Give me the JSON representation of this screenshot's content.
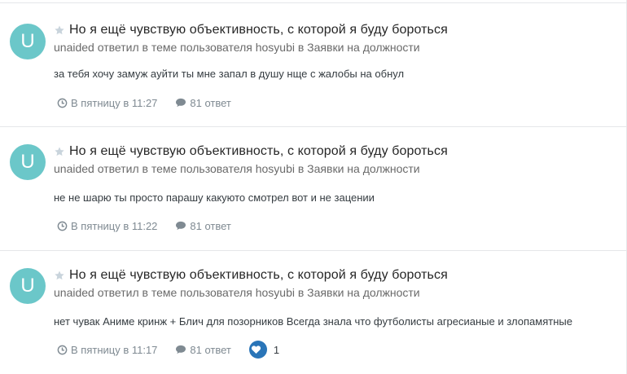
{
  "posts": [
    {
      "avatar_letter": "U",
      "title": "Но я ещё чувствую объективность, с которой я буду бороться",
      "subline": "unaided ответил в теме пользователя hosyubi в Заявки на должности",
      "excerpt": "за тебя хочу замуж ayйти ты мне запал в душу нще с жалобы на обнул",
      "time": "В пятницу в 11:27",
      "replies": "81 ответ",
      "reactions": null
    },
    {
      "avatar_letter": "U",
      "title": "Но я ещё чувствую объективность, с которой я буду бороться",
      "subline": "unaided ответил в теме пользователя hosyubi в Заявки на должности",
      "excerpt": "не не шарю ты просто парашу какуюто смотрел вот и не зацении",
      "time": "В пятницу в 11:22",
      "replies": "81 ответ",
      "reactions": null
    },
    {
      "avatar_letter": "U",
      "title": "Но я ещё чувствую объективность, с которой я буду бороться",
      "subline": "unaided ответил в теме пользователя hosyubi в Заявки на должности",
      "excerpt": "нет чувак Аниме кринж + Блич для позорников Всегда знала что футболисты агресианые и злопамятные",
      "time": "В пятницу в 11:17",
      "replies": "81 ответ",
      "reactions": "1"
    }
  ],
  "colors": {
    "avatar_bg": "#6bc7c9",
    "reaction_bg": "#2a75b8",
    "meta_text": "#7f8a92"
  },
  "icons": {
    "star": "star-icon",
    "clock": "clock-icon",
    "comment": "comment-icon",
    "heart": "heart-icon"
  }
}
